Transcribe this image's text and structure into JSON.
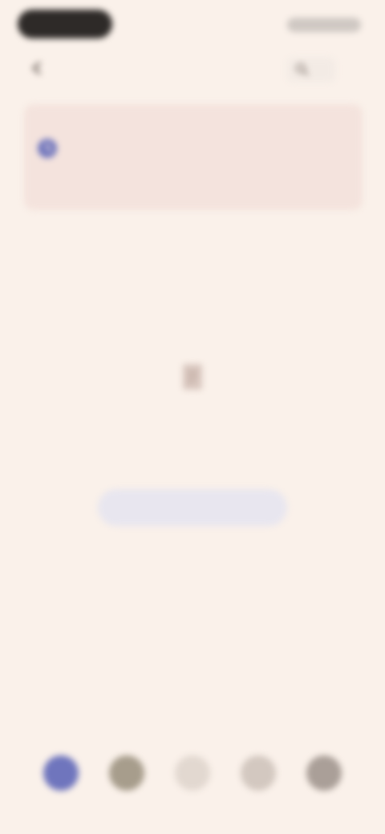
{
  "status_bar": {},
  "header": {
    "title": "",
    "back_icon": "arrow-left-icon",
    "search_icon": "search-icon"
  },
  "banner": {
    "icon": "clock-icon",
    "text": ""
  },
  "empty_state": {
    "icon": "document-icon",
    "title": "",
    "subtitle": "",
    "button_label": ""
  },
  "bottom_nav": {
    "items": [
      {
        "label": "",
        "icon": "home-icon",
        "active": true
      },
      {
        "label": "",
        "icon": "grid-icon",
        "active": false
      },
      {
        "label": "",
        "icon": "plus-icon",
        "active": false
      },
      {
        "label": "",
        "icon": "chat-icon",
        "active": false
      },
      {
        "label": "",
        "icon": "profile-icon",
        "active": false
      }
    ]
  },
  "colors": {
    "background": "#faf1ea",
    "banner": "#f4e3dd",
    "accent": "#5c63b4",
    "button_bg": "#e8e6ef"
  }
}
